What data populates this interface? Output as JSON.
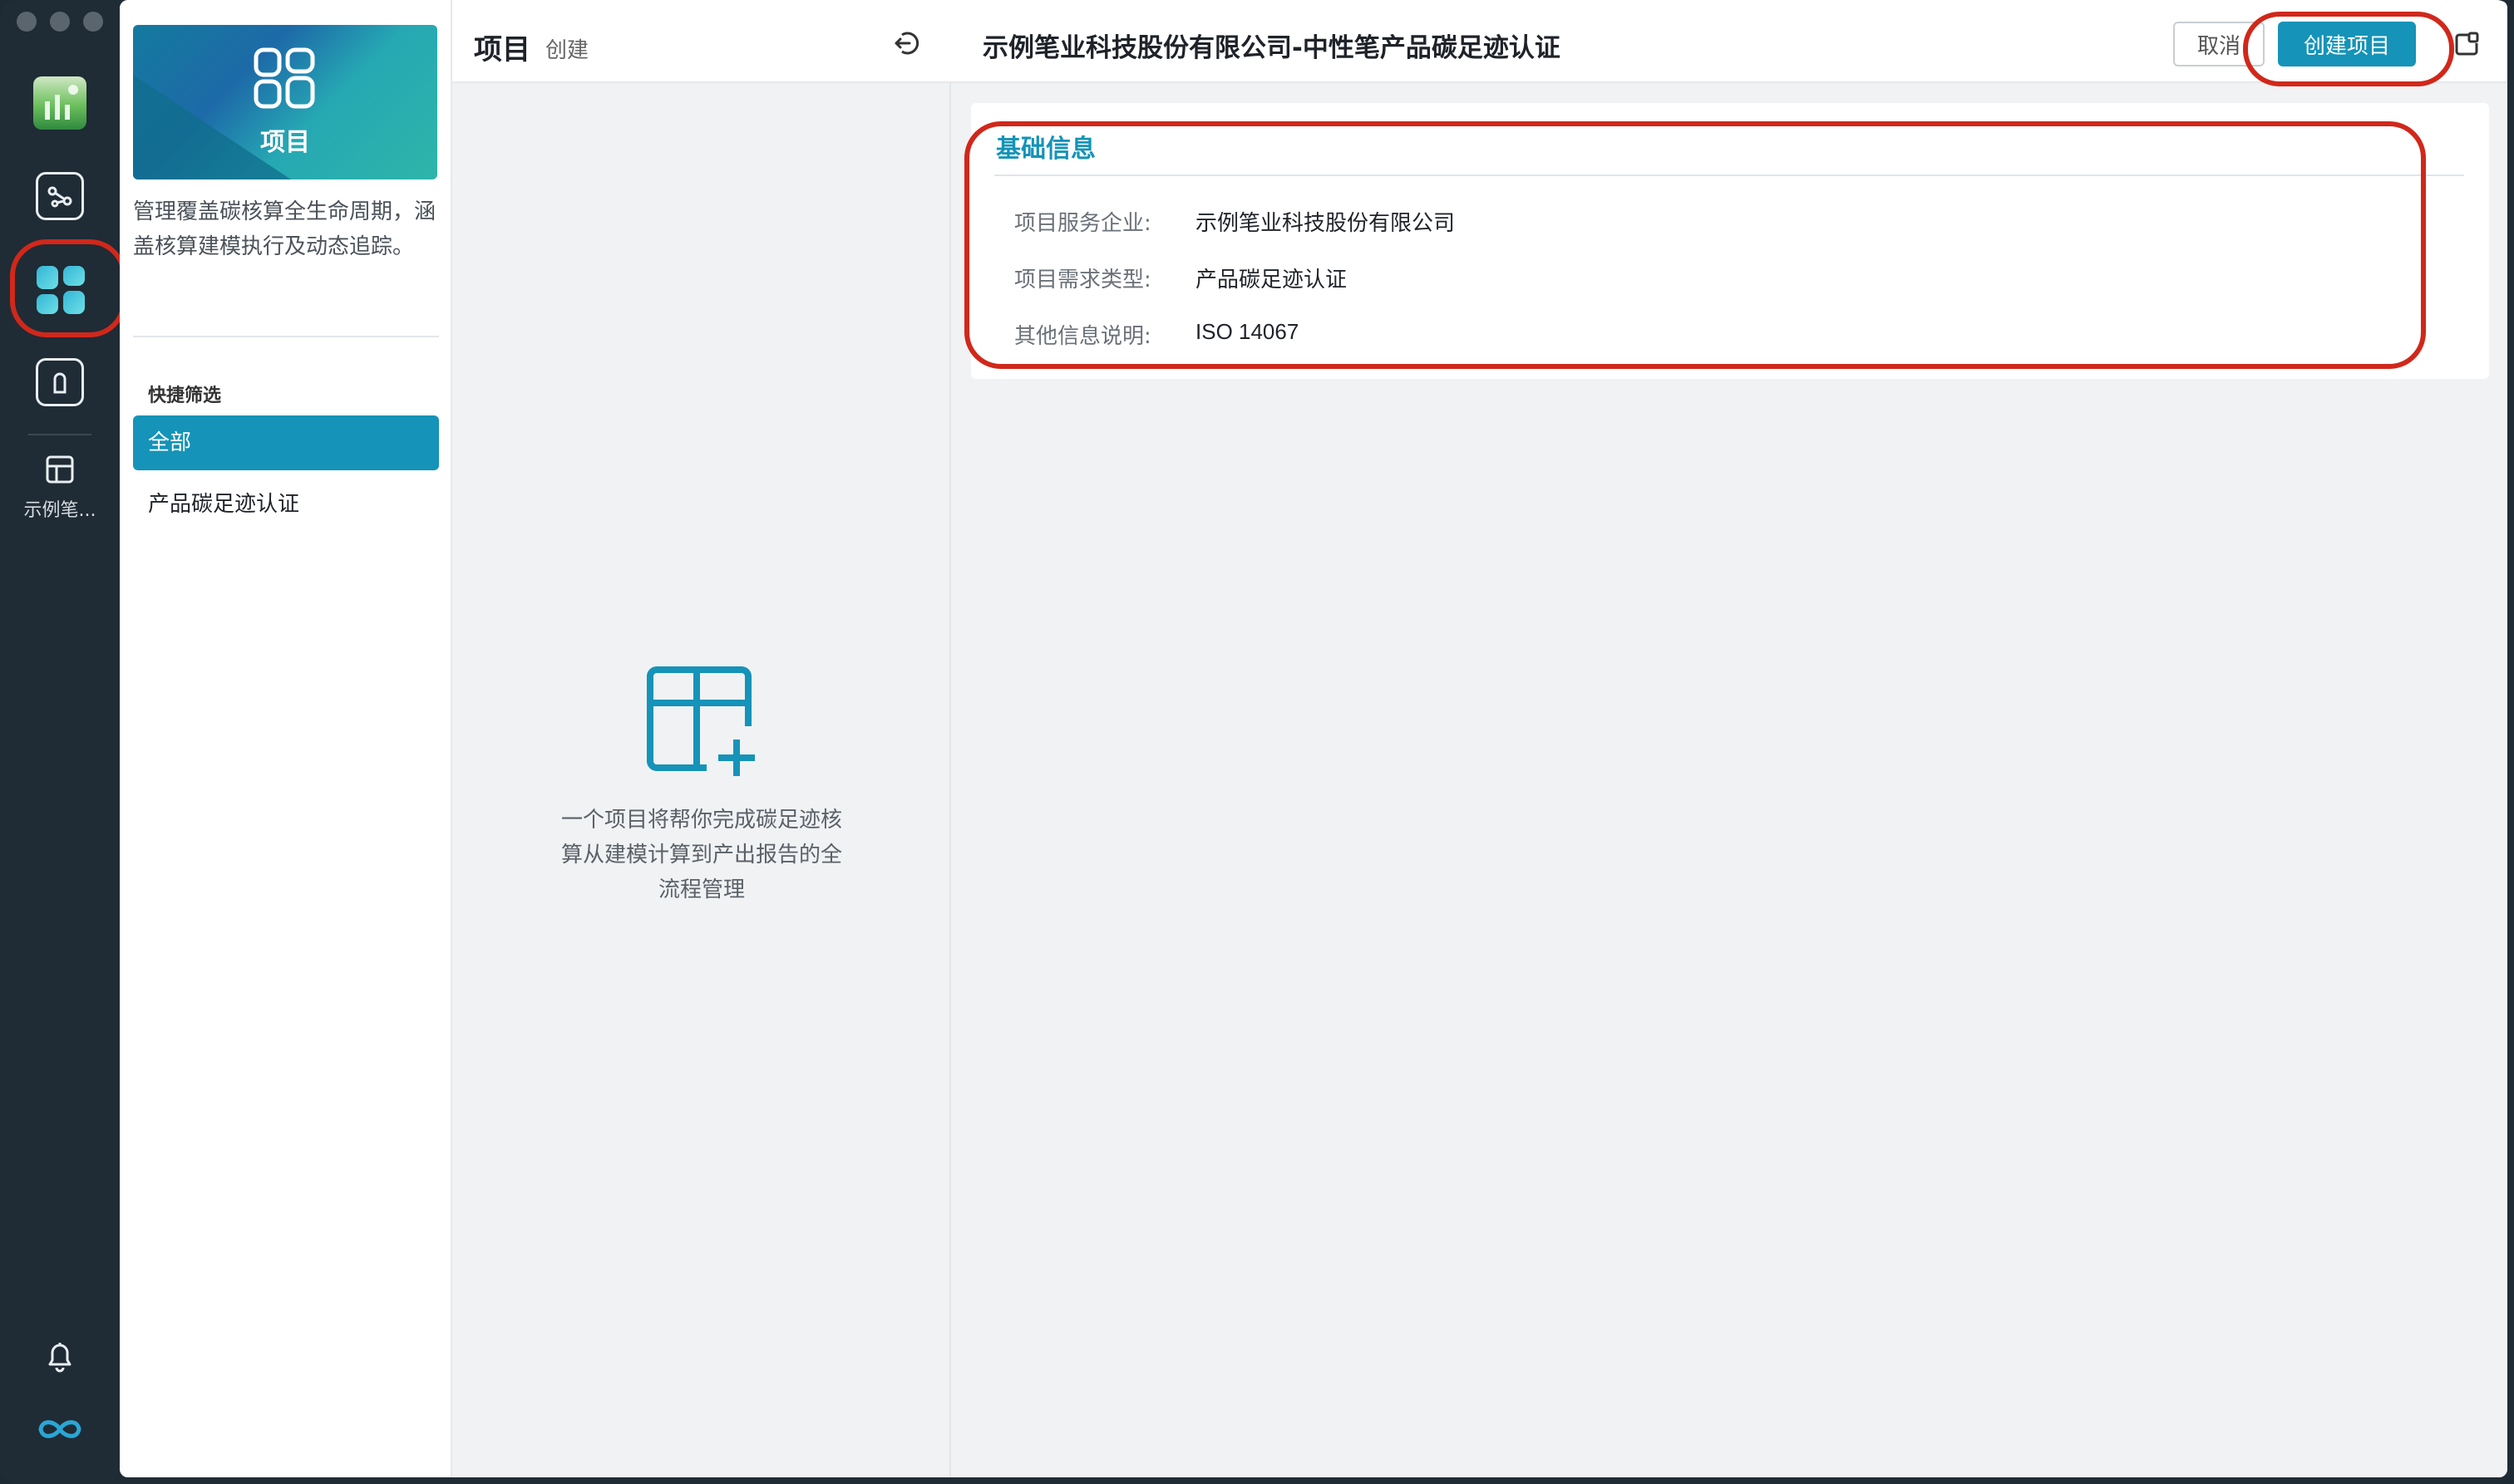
{
  "rail": {
    "items": [
      {
        "icon": "app-logo-icon"
      },
      {
        "icon": "graph-flow-icon"
      },
      {
        "icon": "projects-grid-icon"
      },
      {
        "icon": "keyhole-icon"
      },
      {
        "icon": "table-icon"
      }
    ],
    "workspace_label": "示例笔...",
    "bottom": [
      {
        "icon": "bell-icon"
      },
      {
        "icon": "infinity-icon"
      }
    ]
  },
  "panel1": {
    "banner_label": "项目",
    "description": "管理覆盖碳核算全生命周期，涵盖核算建模执行及动态追踪。",
    "quick_filter_title": "快捷筛选",
    "filters": [
      {
        "label": "全部",
        "active": true
      },
      {
        "label": "产品碳足迹认证",
        "active": false
      }
    ]
  },
  "panel2": {
    "title": "项目",
    "subtitle": "创建",
    "empty_text": "一个项目将帮你完成碳足迹核算从建模计算到产出报告的全流程管理"
  },
  "panel3": {
    "title": "示例笔业科技股份有限公司-中性笔产品碳足迹认证",
    "cancel_label": "取消",
    "create_label": "创建项目",
    "section_title": "基础信息",
    "fields": [
      {
        "label": "项目服务企业:",
        "value": "示例笔业科技股份有限公司"
      },
      {
        "label": "项目需求类型:",
        "value": "产品碳足迹认证"
      },
      {
        "label": "其他信息说明:",
        "value": "ISO 14067"
      }
    ]
  },
  "colors": {
    "accent": "#1593b8",
    "callout": "#d0281b",
    "rail_bg": "#1f2b35"
  }
}
